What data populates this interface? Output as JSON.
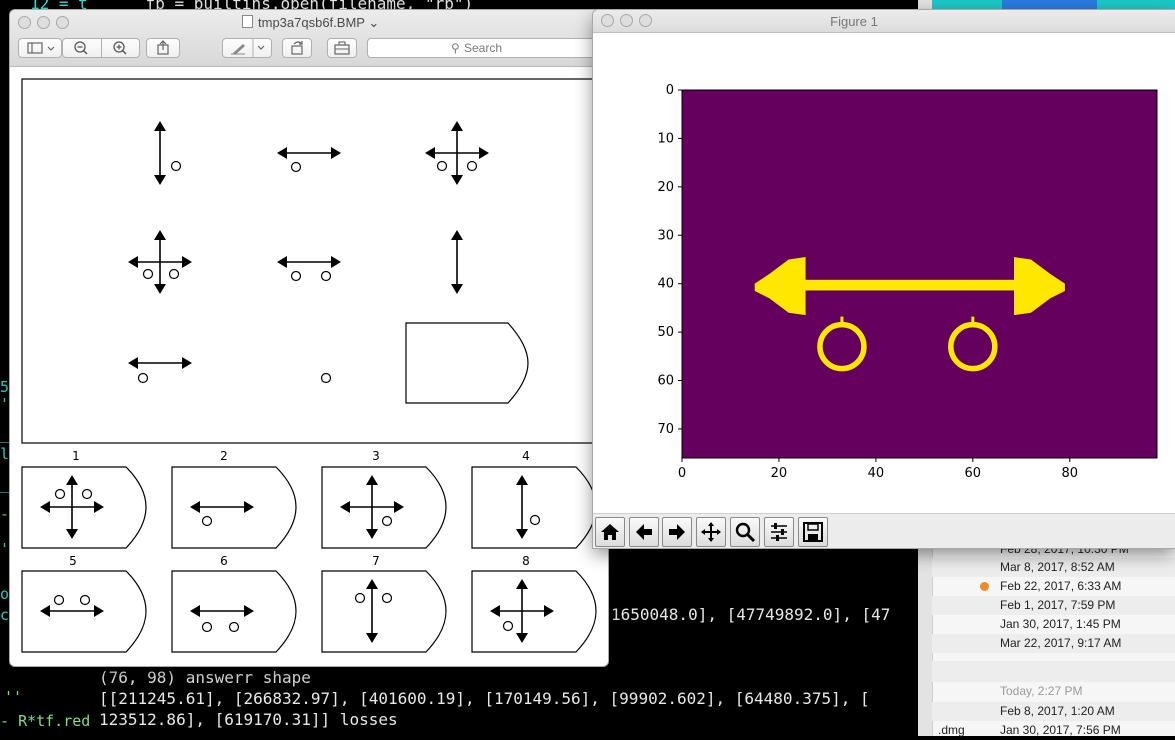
{
  "terminal": {
    "top_line": "fp = builtins.open(filename, \"rb\")",
    "top_num": "12 = t",
    "data_line_tail": "1650048.0], [47749892.0], [47",
    "answer_line": "(76, 98) answerr shape",
    "losses_line1": "[[211245.61], [266832.97], [401600.19], [170149.56], [99902.602], [64480.375], [",
    "losses_line2": "123512.86], [619170.31]] losses",
    "side_snippet": "R*tf.red",
    "side_quote": "''"
  },
  "finder": {
    "rows": [
      {
        "date": "Feb 28, 2017, 10:30 PM",
        "left": "",
        "tag": false,
        "dim": false
      },
      {
        "date": "Mar 8, 2017, 8:52 AM",
        "left": "",
        "tag": false,
        "dim": false
      },
      {
        "date": "Feb 22, 2017, 6:33 AM",
        "left": "",
        "tag": true,
        "dim": false
      },
      {
        "date": "Feb 1, 2017, 7:59 PM",
        "left": "",
        "tag": false,
        "dim": false
      },
      {
        "date": "Jan 30, 2017, 1:45 PM",
        "left": "",
        "tag": false,
        "dim": false
      },
      {
        "date": "Mar 22, 2017, 9:17 AM",
        "left": "",
        "tag": false,
        "dim": false
      },
      {
        "date": "Today, 2:27 PM",
        "left": "",
        "tag": false,
        "dim": true
      },
      {
        "date": "Feb 8, 2017, 1:20 AM",
        "left": "",
        "tag": false,
        "dim": false
      },
      {
        "date": "Jan 30, 2017, 7:56 PM",
        "left": ".dmg",
        "tag": false,
        "dim": false
      }
    ]
  },
  "preview": {
    "title": "tmp3a7qsb6f.BMP",
    "search_placeholder": "Search",
    "choice_labels": [
      "1",
      "2",
      "3",
      "4",
      "5",
      "6",
      "7",
      "8"
    ]
  },
  "figure": {
    "window_title": "Figure 1",
    "colors": {
      "background": "#65005f",
      "foreground": "#ffe700"
    },
    "chart_data": {
      "type": "heatmap",
      "title": "",
      "xlabel": "",
      "ylabel": "",
      "shape": [
        76,
        98
      ],
      "x_ticks": [
        "0",
        "20",
        "40",
        "60",
        "80"
      ],
      "y_ticks": [
        "0",
        "10",
        "20",
        "30",
        "40",
        "50",
        "60",
        "70"
      ],
      "xlim": [
        0,
        98
      ],
      "ylim": [
        76,
        0
      ],
      "content": "double-headed horizontal arrow at row 40 spanning columns 15-93 with two circles centred near (33, 53) and (60, 53)"
    },
    "toolbar": [
      "home-icon",
      "back-icon",
      "forward-icon",
      "pan-icon",
      "zoom-icon",
      "configure-icon",
      "save-icon"
    ]
  }
}
